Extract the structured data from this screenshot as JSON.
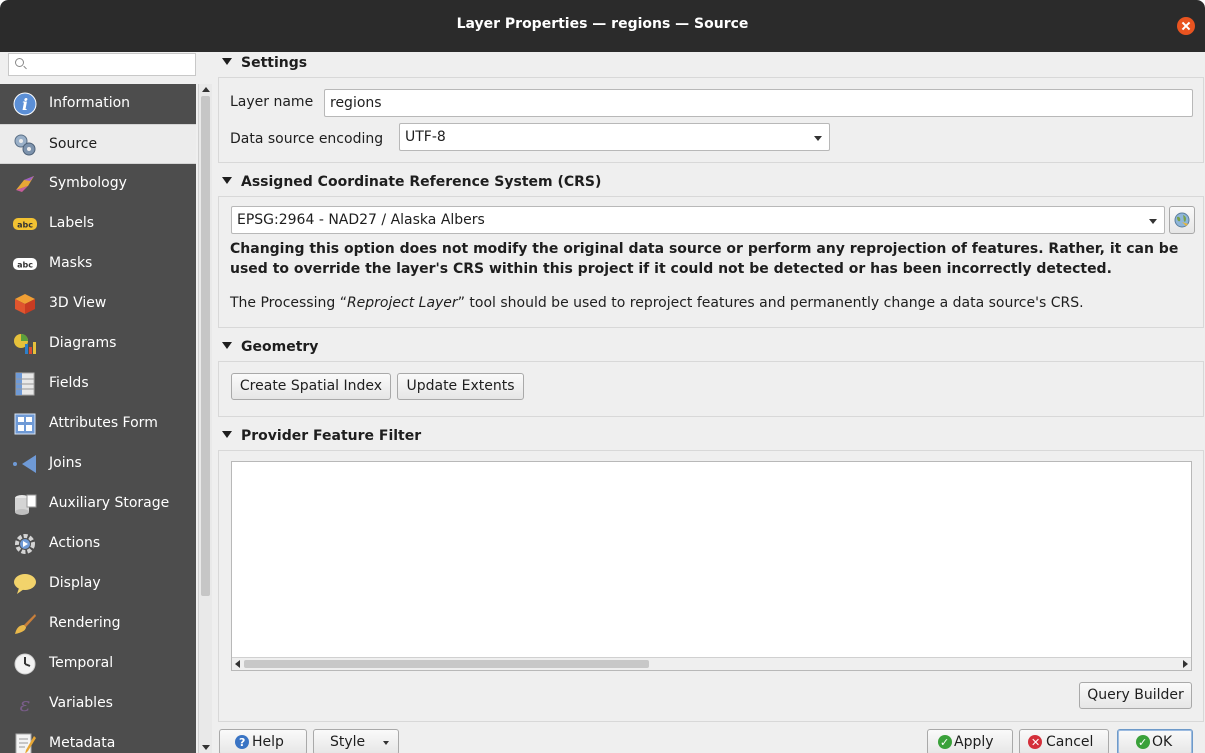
{
  "window": {
    "title": "Layer Properties — regions — Source"
  },
  "sidebar": {
    "search_placeholder": "",
    "items": [
      {
        "label": "Information",
        "icon": "info-icon"
      },
      {
        "label": "Source",
        "icon": "source-icon"
      },
      {
        "label": "Symbology",
        "icon": "symbology-icon"
      },
      {
        "label": "Labels",
        "icon": "labels-icon"
      },
      {
        "label": "Masks",
        "icon": "masks-icon"
      },
      {
        "label": "3D View",
        "icon": "3d-view-icon"
      },
      {
        "label": "Diagrams",
        "icon": "diagrams-icon"
      },
      {
        "label": "Fields",
        "icon": "fields-icon"
      },
      {
        "label": "Attributes Form",
        "icon": "attributes-form-icon"
      },
      {
        "label": "Joins",
        "icon": "joins-icon"
      },
      {
        "label": "Auxiliary Storage",
        "icon": "auxiliary-storage-icon"
      },
      {
        "label": "Actions",
        "icon": "actions-icon"
      },
      {
        "label": "Display",
        "icon": "display-icon"
      },
      {
        "label": "Rendering",
        "icon": "rendering-icon"
      },
      {
        "label": "Temporal",
        "icon": "temporal-icon"
      },
      {
        "label": "Variables",
        "icon": "variables-icon"
      },
      {
        "label": "Metadata",
        "icon": "metadata-icon"
      }
    ],
    "selected": "Source"
  },
  "settings": {
    "header": "Settings",
    "layer_name_label": "Layer name",
    "layer_name_value": "regions",
    "encoding_label": "Data source encoding",
    "encoding_value": "UTF-8"
  },
  "crs": {
    "header": "Assigned Coordinate Reference System (CRS)",
    "value": "EPSG:2964 - NAD27 / Alaska Albers",
    "warning_line1": "Changing this option does not modify the original data source or perform any reprojection of features. Rather, it can be",
    "warning_line2": "used to override the layer's CRS within this project if it could not be detected or has been incorrectly detected.",
    "note_prefix": "The Processing “",
    "note_tool": "Reproject Layer",
    "note_suffix": "” tool should be used to reproject features and permanently change a data source's CRS."
  },
  "geometry": {
    "header": "Geometry",
    "create_index_label": "Create Spatial Index",
    "update_extents_label": "Update Extents"
  },
  "filter": {
    "header": "Provider Feature Filter",
    "query_builder_label": "Query Builder"
  },
  "buttons": {
    "help": "Help",
    "style": "Style",
    "apply": "Apply",
    "cancel": "Cancel",
    "ok": "OK"
  },
  "colors": {
    "sidebar_bg": "#4d4d4d",
    "titlebar_bg": "#2b2b2b",
    "close_button": "#e95420",
    "apply_icon": "#3aa13a",
    "cancel_icon": "#d42f3a",
    "help_icon": "#3a74c4"
  }
}
